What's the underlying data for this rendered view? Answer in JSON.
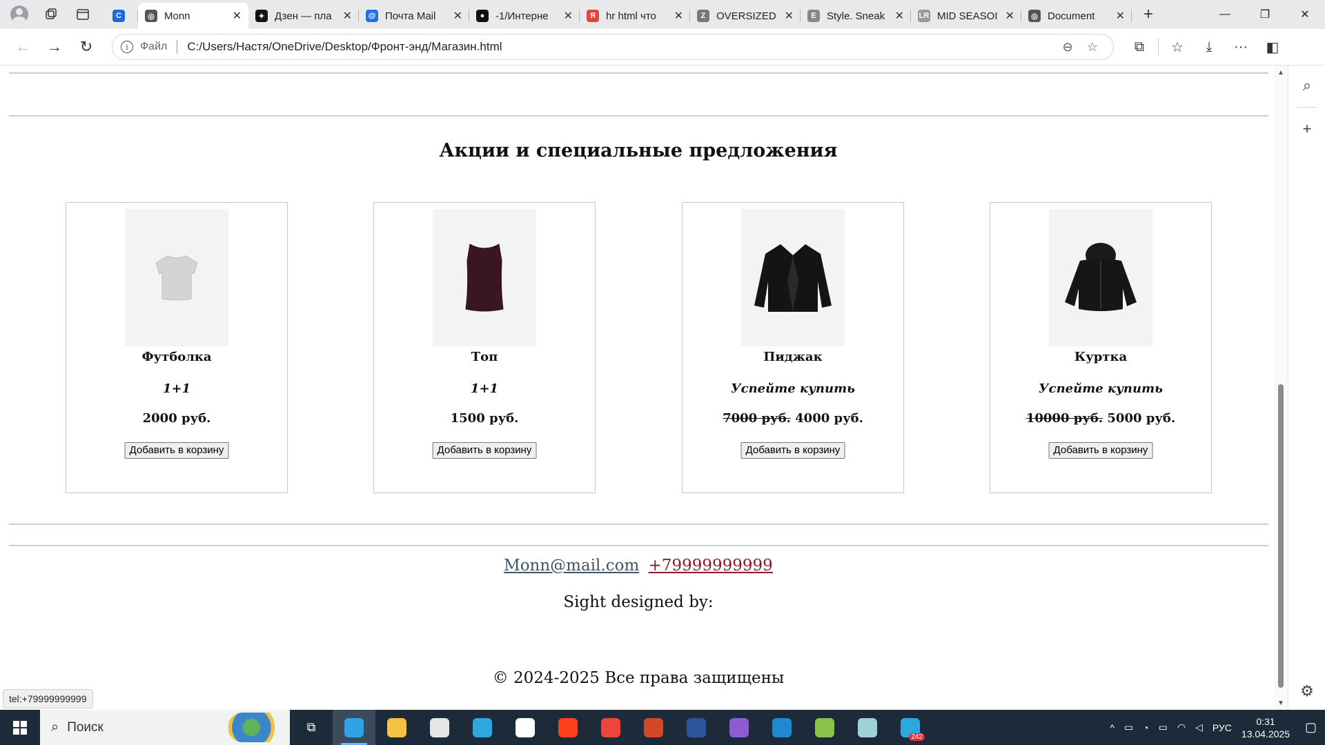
{
  "browser": {
    "tabs": [
      {
        "title": "",
        "icon": "copilot-icon",
        "color": "#1b6cd9",
        "glyph": "C",
        "active": false,
        "narrow": true
      },
      {
        "title": "Monn",
        "icon": "globe-icon",
        "color": "#555555",
        "glyph": "◎",
        "active": true
      },
      {
        "title": "Дзен — пла",
        "icon": "dzen-icon",
        "color": "#111111",
        "glyph": "✦",
        "active": false
      },
      {
        "title": "Почта Mail",
        "icon": "mail-icon",
        "color": "#1a73e8",
        "glyph": "@",
        "active": false
      },
      {
        "title": "-1/Интерне",
        "icon": "github-icon",
        "color": "#111111",
        "glyph": "●",
        "active": false
      },
      {
        "title": "hr html что",
        "icon": "yandex-icon",
        "color": "#e0453a",
        "glyph": "Я",
        "active": false
      },
      {
        "title": "OVERSIZED",
        "icon": "zara-icon",
        "color": "#777777",
        "glyph": "Z",
        "active": false
      },
      {
        "title": "Style. Sneak",
        "icon": "e-icon",
        "color": "#888888",
        "glyph": "E",
        "active": false
      },
      {
        "title": "MID SEASOI",
        "icon": "lr-icon",
        "color": "#999999",
        "glyph": "LR",
        "active": false
      },
      {
        "title": "Document",
        "icon": "globe-icon",
        "color": "#555555",
        "glyph": "◎",
        "active": false
      }
    ],
    "address": {
      "scheme_label": "Файл",
      "url": "C:/Users/Настя/OneDrive/Desktop/Фронт-энд/Магазин.html"
    }
  },
  "page": {
    "section_title": "Акции и специальные предложения",
    "products": [
      {
        "name": "Футболка",
        "promo": "1+1",
        "old_price": "",
        "price": "2000 руб.",
        "button": "Добавить в корзину",
        "item": "tshirt"
      },
      {
        "name": "Топ",
        "promo": "1+1",
        "old_price": "",
        "price": "1500 руб.",
        "button": "Добавить в корзину",
        "item": "top"
      },
      {
        "name": "Пиджак",
        "promo": "Успейте купить",
        "old_price": "7000 руб.",
        "price": "4000 руб.",
        "button": "Добавить в корзину",
        "item": "blazer"
      },
      {
        "name": "Куртка",
        "promo": "Успейте купить",
        "old_price": "10000 руб.",
        "price": "5000 руб.",
        "button": "Добавить в корзину",
        "item": "jacket"
      }
    ],
    "contacts": {
      "email": "Monn@mail.com",
      "phone": "+79999999999"
    },
    "designed_by": "Sight designed by:",
    "copyright": "© 2024-2025 Все права защищены",
    "status_link": "tel:+79999999999"
  },
  "taskbar": {
    "search_placeholder": "Поиск",
    "apps": [
      "edge-icon",
      "file-explorer-icon",
      "paint-icon",
      "telegram-icon",
      "store-icon",
      "yandex-icon",
      "anydesk-icon",
      "powerpoint-icon",
      "word-icon",
      "visual-studio-icon",
      "vscode-icon",
      "notepad-plus-icon",
      "app-icon",
      "telegram-icon"
    ],
    "telegram_badge": "242",
    "language": "РУС",
    "time": "0:31",
    "date": "13.04.2025"
  }
}
